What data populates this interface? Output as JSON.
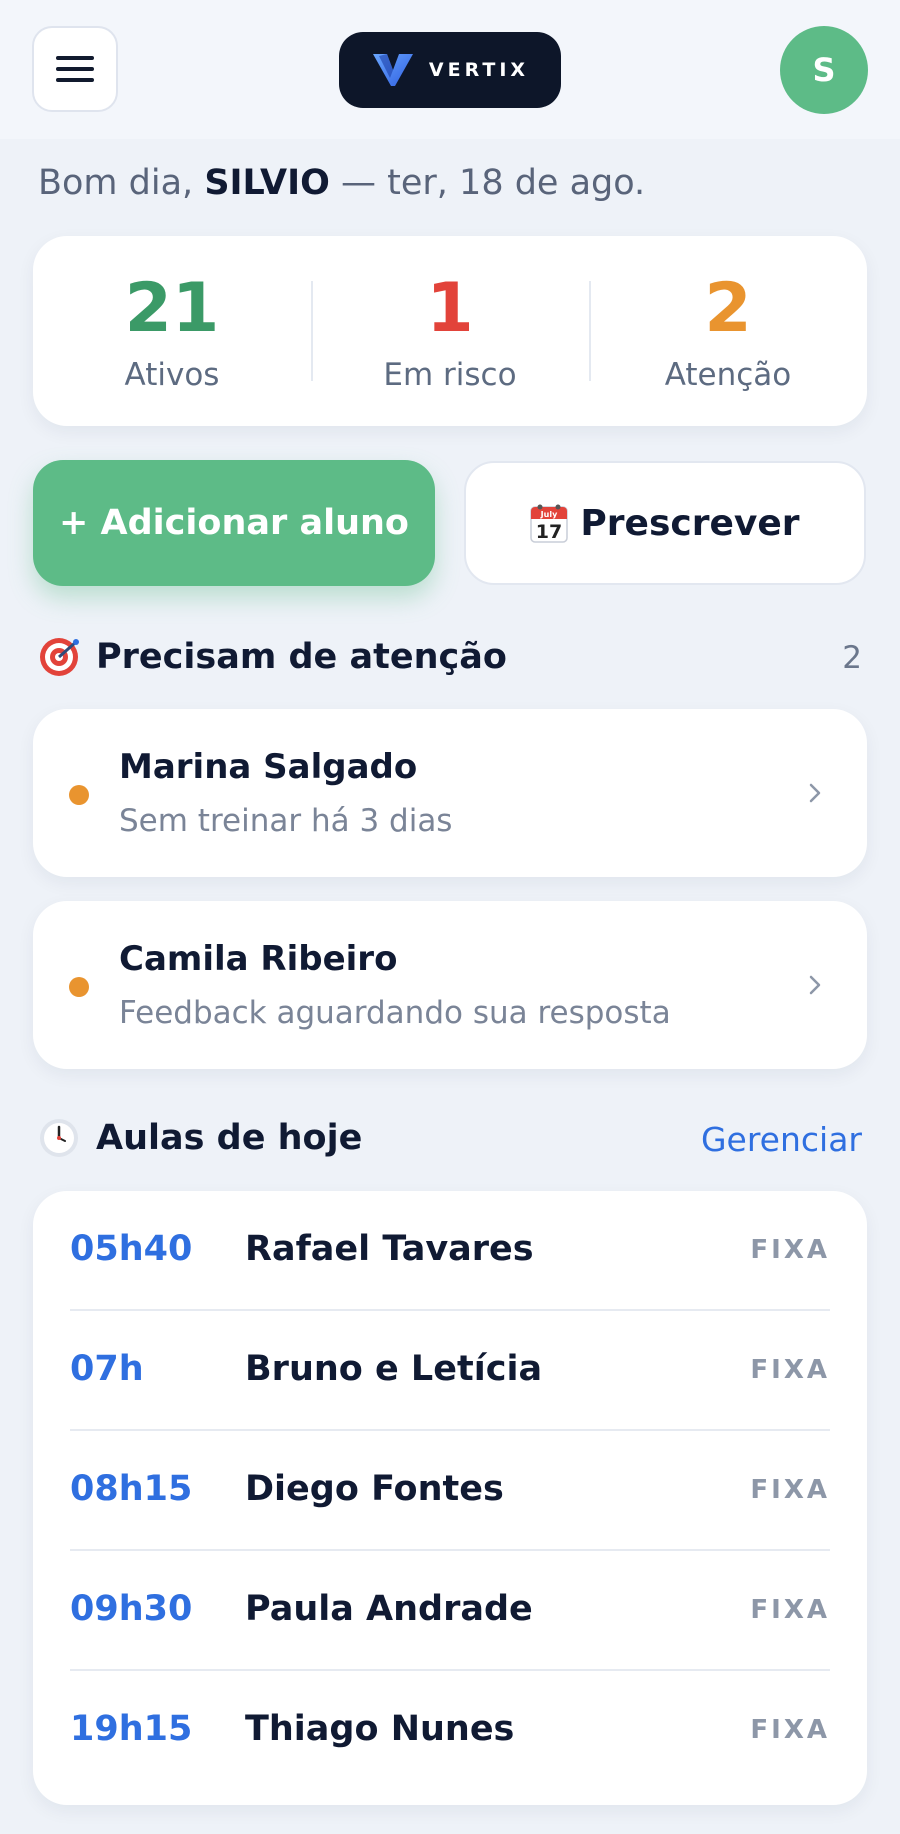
{
  "header": {
    "logo_text": "VERTIX",
    "avatar_initial": "S"
  },
  "greeting": {
    "prefix": "Bom dia,",
    "name": "SILVIO",
    "date": "— ter, 18 de ago."
  },
  "stats": [
    {
      "value": "21",
      "label": "Ativos",
      "color": "#3b9a67"
    },
    {
      "value": "1",
      "label": "Em risco",
      "color": "#e2433a"
    },
    {
      "value": "2",
      "label": "Atenção",
      "color": "#e9942f"
    }
  ],
  "actions": {
    "add_label": "+ Adicionar aluno",
    "prescribe_label": "Prescrever"
  },
  "attention": {
    "title": "Precisam de atenção",
    "count": "2",
    "items": [
      {
        "name": "Marina Salgado",
        "desc": "Sem treinar há 3 dias"
      },
      {
        "name": "Camila Ribeiro",
        "desc": "Feedback aguardando sua resposta"
      }
    ]
  },
  "classes": {
    "title": "Aulas de hoje",
    "link": "Gerenciar",
    "items": [
      {
        "time": "05h40",
        "name": "Rafael Tavares",
        "badge": "FIXA"
      },
      {
        "time": "07h",
        "name": "Bruno e Letícia",
        "badge": "FIXA"
      },
      {
        "time": "08h15",
        "name": "Diego Fontes",
        "badge": "FIXA"
      },
      {
        "time": "09h30",
        "name": "Paula Andrade",
        "badge": "FIXA"
      },
      {
        "time": "19h15",
        "name": "Thiago Nunes",
        "badge": "FIXA"
      }
    ]
  },
  "colors": {
    "accent_green": "#5dbb87",
    "accent_blue": "#2f6fe0",
    "warning_orange": "#e9942f",
    "danger_red": "#e2433a"
  }
}
